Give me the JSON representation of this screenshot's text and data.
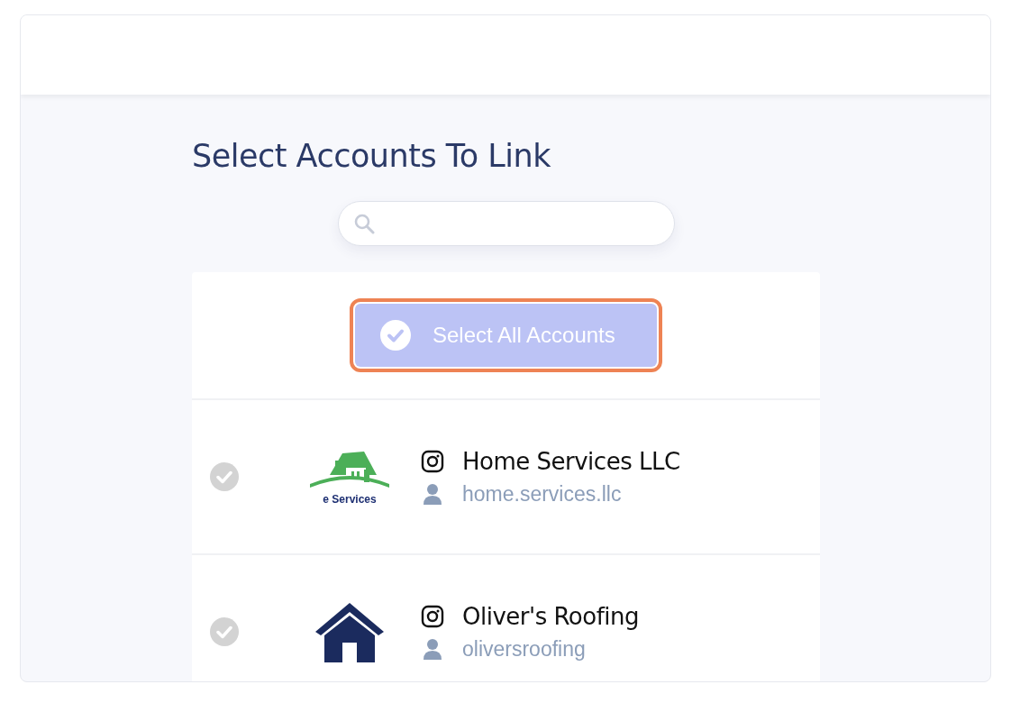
{
  "title": "Select Accounts To Link",
  "select_all": {
    "label": "Select All Accounts",
    "highlighted": true
  },
  "accounts": [
    {
      "name": "Home Services LLC",
      "handle": "home.services.llc",
      "selected": false,
      "kind": "green-house",
      "logo_text": "e Services"
    },
    {
      "name": "Oliver's Roofing",
      "handle": "oliversroofing",
      "selected": false,
      "kind": "navy-house"
    }
  ]
}
